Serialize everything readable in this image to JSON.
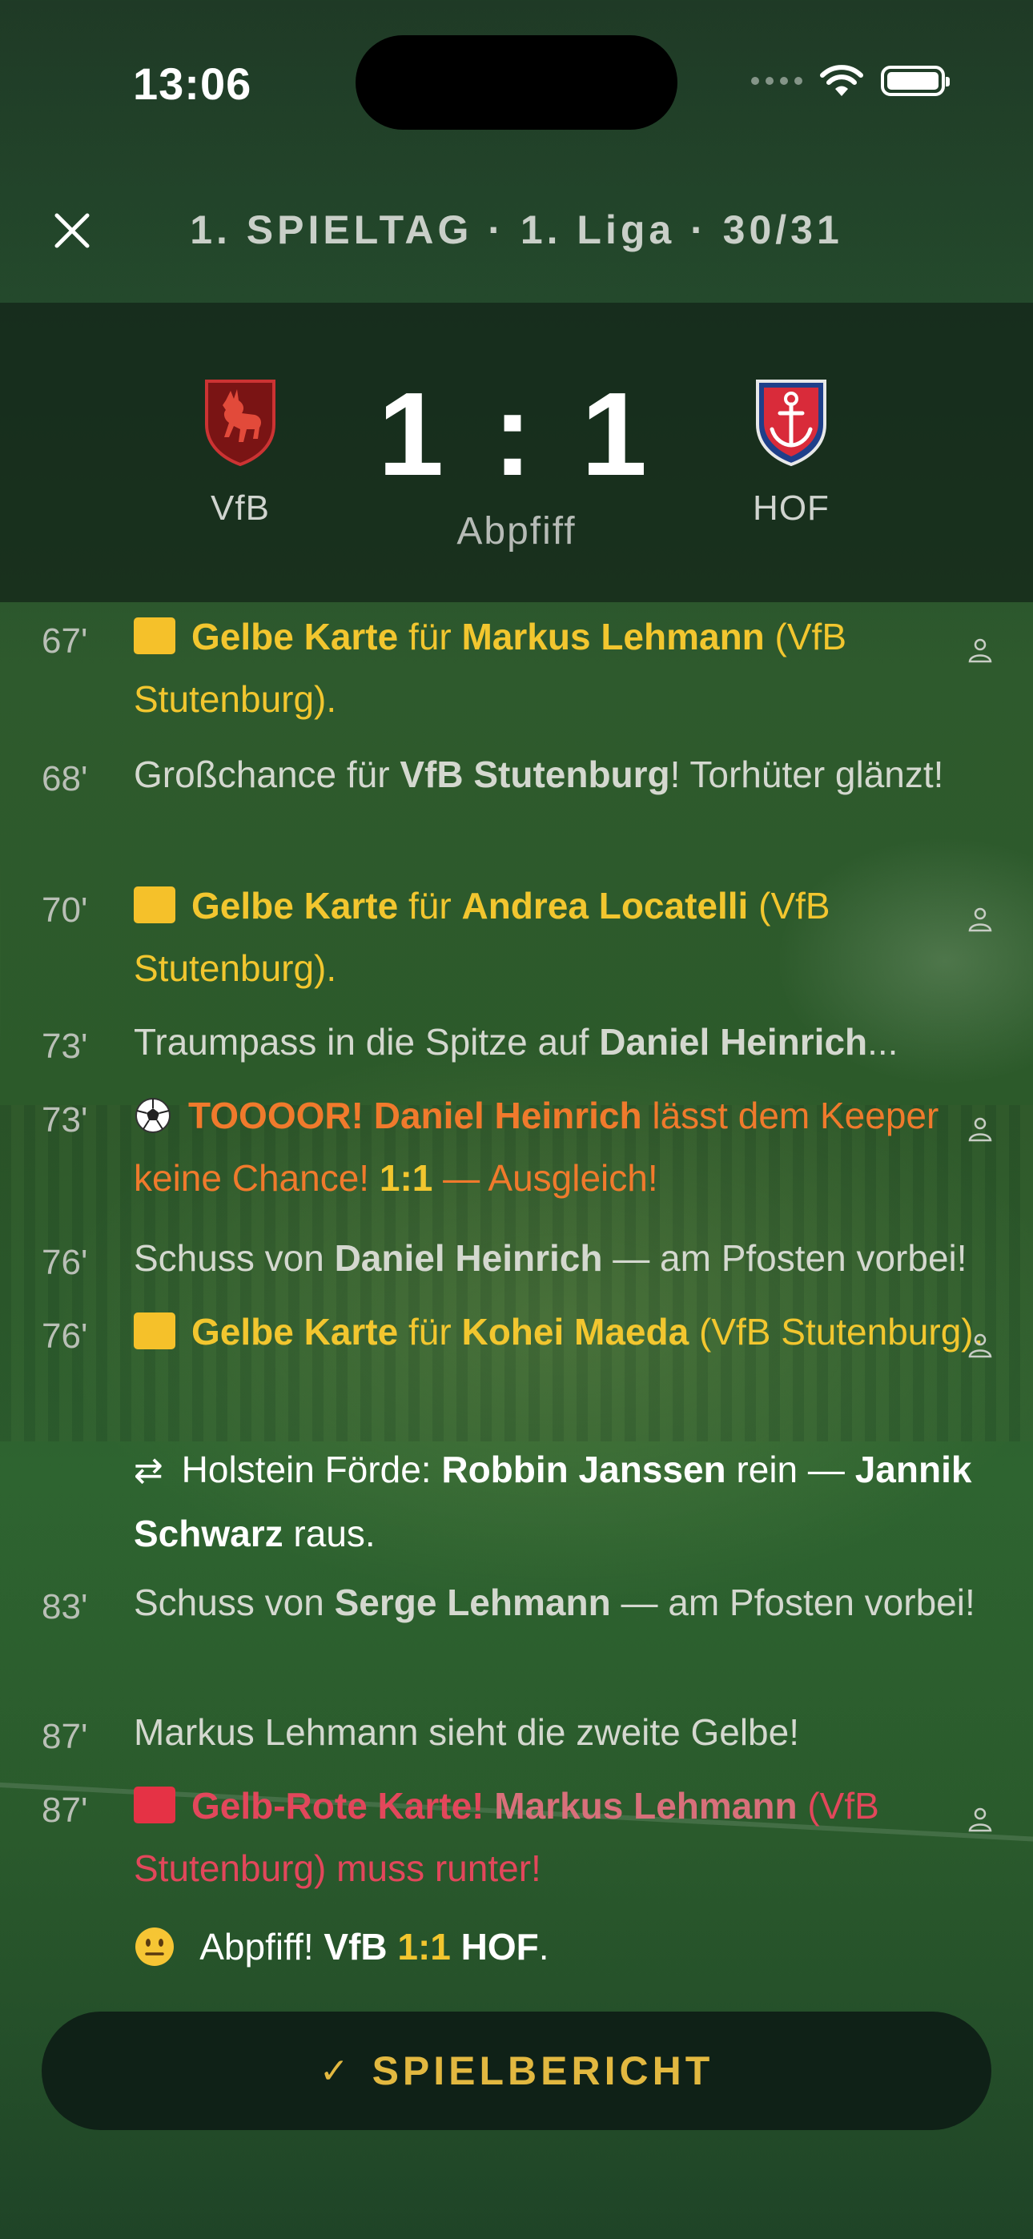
{
  "status_bar": {
    "time": "13:06"
  },
  "nav": {
    "title": "1. SPIELTAG · 1. Liga · 30/31"
  },
  "match": {
    "home": "VfB",
    "away": "HOF",
    "score": "1 : 1",
    "status": "Abpfiff"
  },
  "events": [
    {
      "minute": "67'",
      "kind": "yellow",
      "label": "Gelbe Karte",
      "mid": " für ",
      "player": "Markus Lehmann",
      "club": " (VfB Stutenburg)."
    },
    {
      "minute": "68'",
      "kind": "plain",
      "pre": "Großchance für ",
      "bold": "VfB Stutenburg",
      "post": "! Torhüter glänzt!"
    },
    {
      "minute": "70'",
      "kind": "yellow",
      "label": "Gelbe Karte",
      "mid": " für ",
      "player": "Andrea Locatelli",
      "club": " (VfB Stutenburg)."
    },
    {
      "minute": "73'",
      "kind": "plain",
      "pre": "Traumpass in die Spitze auf ",
      "bold": "Daniel Heinrich",
      "post": "..."
    },
    {
      "minute": "73'",
      "kind": "goal",
      "label": "TOOOOR!",
      "player": " Daniel Heinrich",
      "mid": " lässt dem Keeper keine Chance! ",
      "score": "1:1",
      "post": " — Ausgleich!"
    },
    {
      "minute": "76'",
      "kind": "plain",
      "pre": "Schuss von ",
      "bold": "Daniel Heinrich",
      "post": " — am Pfosten vorbei!"
    },
    {
      "minute": "76'",
      "kind": "yellow",
      "label": "Gelbe Karte",
      "mid": " für ",
      "player": "Kohei Maeda",
      "club": " (VfB Stutenburg)."
    },
    {
      "minute": "",
      "kind": "sub",
      "swap": "⇄",
      "team": " Holstein Förde: ",
      "in": "Robbin Janssen",
      "mid": " rein — ",
      "out": "Jannik Schwarz",
      "post": " raus."
    },
    {
      "minute": "83'",
      "kind": "plain",
      "pre": "Schuss von ",
      "bold": "Serge Lehmann",
      "post": " — am Pfosten vorbei!"
    },
    {
      "minute": "87'",
      "kind": "plain",
      "pre": "Markus Lehmann sieht die zweite Gelbe!",
      "bold": "",
      "post": ""
    },
    {
      "minute": "87'",
      "kind": "red",
      "label": "Gelb-Rote Karte!",
      "player": " Markus Lehmann",
      "club": " (VfB Stutenburg)",
      "post": " muss runter!"
    },
    {
      "minute": "",
      "kind": "final",
      "pre": " Abpfiff! ",
      "home": "VfB",
      "score": " 1:1 ",
      "away": "HOF",
      "post": "."
    }
  ],
  "button": {
    "label": "SPIELBERICHT"
  },
  "colors": {
    "accent": "#f2c62f",
    "goal": "#f07a2c",
    "red": "#e2475b",
    "button_text": "#e2b840"
  }
}
